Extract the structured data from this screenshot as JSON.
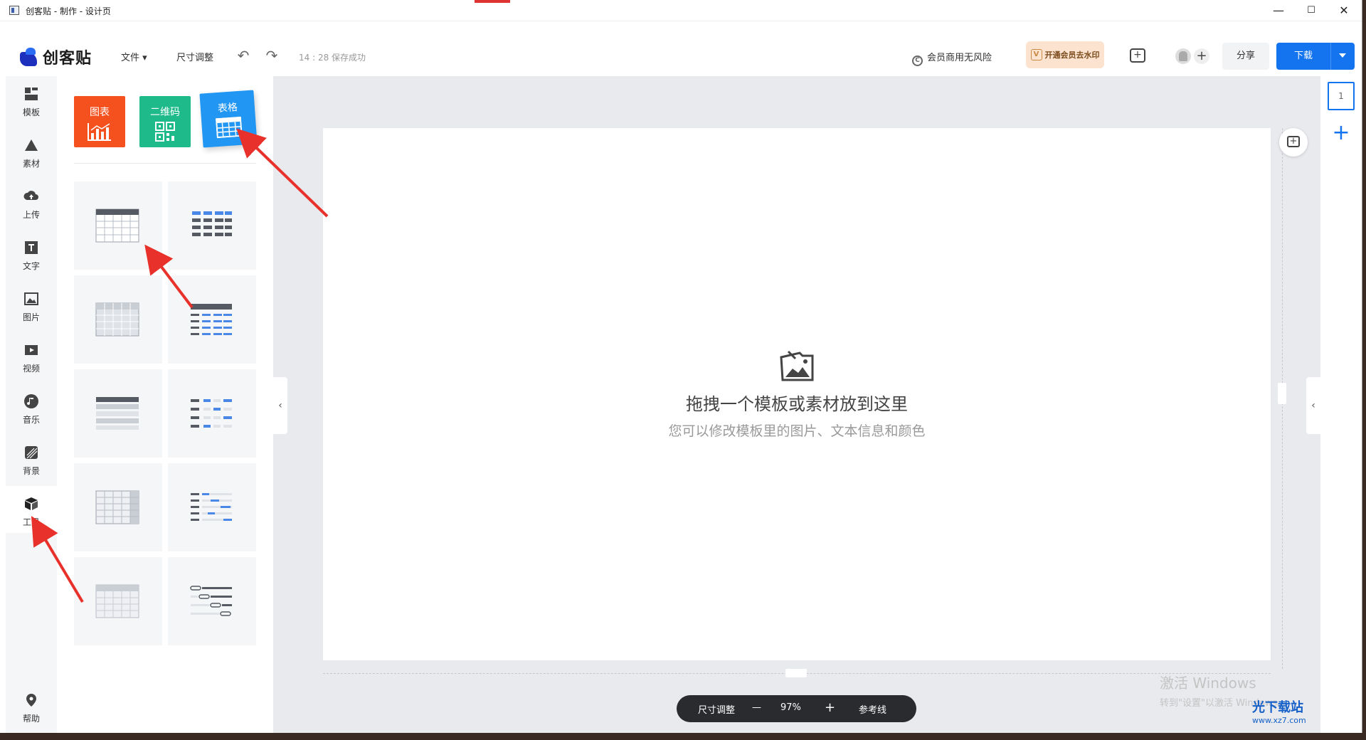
{
  "window": {
    "title": "创客贴 - 制作 - 设计页",
    "minimize": "—",
    "maximize": "☐",
    "close": "✕"
  },
  "header": {
    "logo": "创客贴",
    "file_menu": "文件 ▾",
    "resize": "尺寸调整",
    "save_status": "14 : 28 保存成功",
    "commercial": "会员商用无风险",
    "commercial_badge": "C",
    "vip_badge": "V",
    "vip": "开通会员去水印",
    "share": "分享",
    "download": "下载"
  },
  "rail": {
    "items": [
      {
        "label": "模板",
        "icon": "template-icon"
      },
      {
        "label": "素材",
        "icon": "material-icon"
      },
      {
        "label": "上传",
        "icon": "upload-icon"
      },
      {
        "label": "文字",
        "icon": "text-icon"
      },
      {
        "label": "图片",
        "icon": "image-icon"
      },
      {
        "label": "视频",
        "icon": "video-icon"
      },
      {
        "label": "音乐",
        "icon": "music-icon"
      },
      {
        "label": "背景",
        "icon": "background-icon"
      },
      {
        "label": "工具",
        "icon": "tools-icon"
      }
    ],
    "active": "工具",
    "help": "帮助"
  },
  "tools": {
    "chart": "图表",
    "qrcode": "二维码",
    "table": "表格"
  },
  "canvas": {
    "hint_title": "拖拽一个模板或素材放到这里",
    "hint_sub": "您可以修改模板里的图片、文本信息和颜色"
  },
  "bottom_bar": {
    "resize": "尺寸调整",
    "minus": "—",
    "zoom": "97%",
    "plus": "+",
    "guides": "参考线"
  },
  "pages": {
    "current": "1",
    "add": "+"
  },
  "watermark": {
    "line1": "激活 Windows",
    "line2": "转到\"设置\"以激活 Windows。",
    "site": "光下载站",
    "url": "www.xz7.com"
  },
  "colors": {
    "chart_tile": "#f4511e",
    "qrcode_tile": "#1fba8a",
    "table_tile": "#2196f3",
    "accent": "#1473ef",
    "annotation": "#e8312a"
  }
}
